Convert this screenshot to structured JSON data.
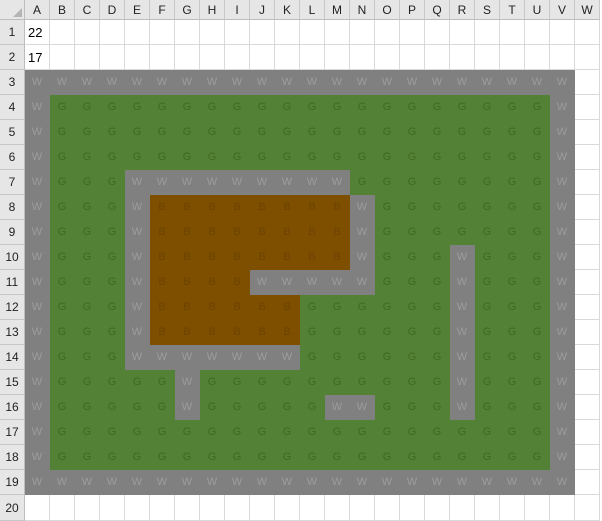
{
  "columns": [
    "A",
    "B",
    "C",
    "D",
    "E",
    "F",
    "G",
    "H",
    "I",
    "J",
    "K",
    "L",
    "M",
    "N",
    "O",
    "P",
    "Q",
    "R",
    "S",
    "T",
    "U",
    "V",
    "W"
  ],
  "rows": [
    "1",
    "2",
    "3",
    "4",
    "5",
    "6",
    "7",
    "8",
    "9",
    "10",
    "11",
    "12",
    "13",
    "14",
    "15",
    "16",
    "17",
    "18",
    "19",
    "20"
  ],
  "cell_values": {
    "A1": "22",
    "A2": "17"
  },
  "grid": [
    "WWWWWWWWWWWWWWWWWWWWWW",
    "WGGGGGGGGGGGGGGGGGGGGW",
    "WGGGGGGGGGGGGGGGGGGGGW",
    "WGGGGGGGGGGGGGGGGGGGGW",
    "WGGGWWWWWWWWWGGGGGGGGW",
    "WGGGWBBBBBBBBWGGGGGGGW",
    "WGGGWBBBBBBBBWGGGGGGGW",
    "WGGGWBBBBBBBBWGGGWGGGW",
    "WGGGWBBBBWWWWWGGGWGGGW",
    "WGGGWBBBBBBGGGGGGWGGGW",
    "WGGGWBBBBBBGGGGGGWGGGW",
    "WGGGWWWWWWWGGGGGGWGGGW",
    "WGGGGGWGGGGGGGGGGWGGGW",
    "WGGGGGWGGGGGWWGGGWGGGW",
    "WGGGGGGGGGGGGGGGGGGGGW",
    "WGGGGGGGGGGGGGGGGGGGGW",
    "WWWWWWWWWWWWWWWWWWWWWW"
  ],
  "grid_start_row": "3",
  "grid_start_col": "A",
  "colors": {
    "wall": "#808080",
    "grass": "#538135",
    "building": "#7f4f00",
    "header_bg": "#e6e6e6"
  }
}
